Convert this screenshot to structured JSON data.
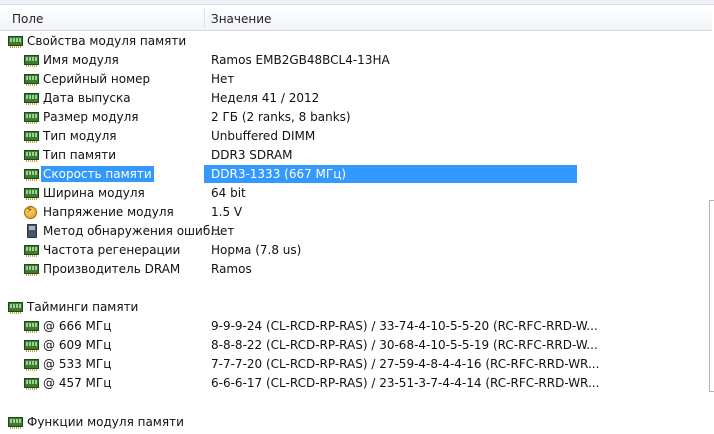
{
  "header": {
    "col_field": "Поле",
    "col_value": "Значение"
  },
  "group1": {
    "title": "Свойства модуля памяти",
    "items": [
      {
        "label": "Имя модуля",
        "value": "Ramos EMB2GB48BCL4-13HA",
        "icon": "memory-module-icon"
      },
      {
        "label": "Серийный номер",
        "value": "Нет",
        "icon": "memory-module-icon"
      },
      {
        "label": "Дата выпуска",
        "value": "Неделя 41 / 2012",
        "icon": "memory-module-icon"
      },
      {
        "label": "Размер модуля",
        "value": "2 ГБ (2 ranks, 8 banks)",
        "icon": "memory-module-icon"
      },
      {
        "label": "Тип модуля",
        "value": "Unbuffered DIMM",
        "icon": "memory-module-icon"
      },
      {
        "label": "Тип памяти",
        "value": "DDR3 SDRAM",
        "icon": "memory-module-icon"
      },
      {
        "label": "Скорость памяти",
        "value": "DDR3-1333 (667 МГц)",
        "icon": "memory-module-icon",
        "selected": true
      },
      {
        "label": "Ширина модуля",
        "value": "64 bit",
        "icon": "memory-module-icon"
      },
      {
        "label": "Напряжение модуля",
        "value": "1.5 V",
        "icon": "voltage-icon"
      },
      {
        "label": "Метод обнаружения ошиб...",
        "value": "Нет",
        "icon": "detection-method-icon"
      },
      {
        "label": "Частота регенерации",
        "value": "Норма (7.8 us)",
        "icon": "memory-module-icon"
      },
      {
        "label": "Производитель DRAM",
        "value": "Ramos",
        "icon": "memory-module-icon"
      }
    ]
  },
  "group2": {
    "title": "Тайминги памяти",
    "items": [
      {
        "label": "@ 666 МГц",
        "value": "9-9-9-24  (CL-RCD-RP-RAS) / 33-74-4-10-5-5-20  (RC-RFC-RRD-W..."
      },
      {
        "label": "@ 609 МГц",
        "value": "8-8-8-22  (CL-RCD-RP-RAS) / 30-68-4-10-5-5-19  (RC-RFC-RRD-W..."
      },
      {
        "label": "@ 533 МГц",
        "value": "7-7-7-20  (CL-RCD-RP-RAS) / 27-59-4-8-4-4-16  (RC-RFC-RRD-WR..."
      },
      {
        "label": "@ 457 МГц",
        "value": "6-6-6-17  (CL-RCD-RP-RAS) / 23-51-3-7-4-4-14  (RC-RFC-RRD-WR..."
      }
    ]
  },
  "group3": {
    "title": "Функции модуля памяти"
  },
  "colors": {
    "selection": "#3399ff",
    "module_green": "#3b7a35"
  }
}
